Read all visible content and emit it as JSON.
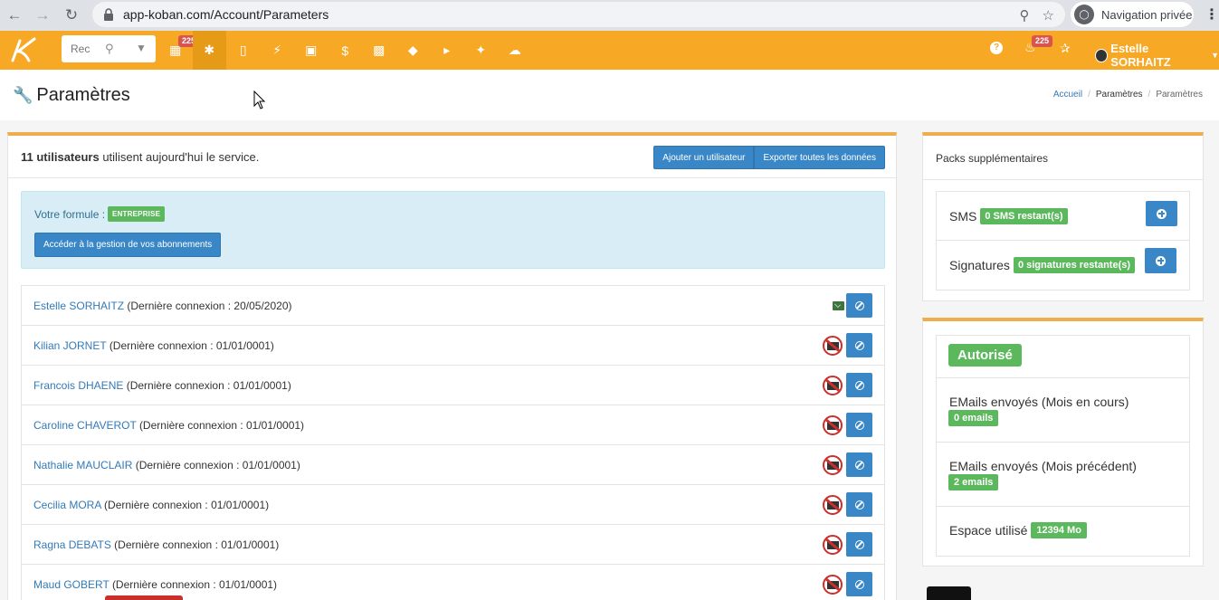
{
  "browser": {
    "url": "app-koban.com/Account/Parameters",
    "incognito_label": "Navigation privée"
  },
  "navbar": {
    "search_placeholder": "Rec",
    "calendar_badge": "225",
    "notification_badge": "225",
    "user_name": "Estelle SORHAITZ",
    "accent_color": "#f7a825"
  },
  "page": {
    "title": "Paramètres",
    "breadcrumb": [
      "Accueil",
      "Paramètres",
      "Paramètres"
    ]
  },
  "main": {
    "user_count": "11 utilisateurs",
    "user_count_suffix": " utilisent aujourd'hui le service.",
    "add_user_button": "Ajouter un utilisateur",
    "export_button": "Exporter toutes les données",
    "formule_label": "Votre formule :",
    "formule_value": "ENTREPRISE",
    "manage_subscriptions_button": "Accéder à la gestion de vos abonnements",
    "users": [
      {
        "name": "Estelle SORHAITZ",
        "last_login": "(Dernière connexion : 20/05/2020)",
        "mail_icon": "envelope-icon"
      },
      {
        "name": "Kilian JORNET",
        "last_login": "(Dernière connexion : 01/01/0001)",
        "mail_icon": "no-mail-icon"
      },
      {
        "name": "Francois DHAENE",
        "last_login": "(Dernière connexion : 01/01/0001)",
        "mail_icon": "no-mail-icon"
      },
      {
        "name": "Caroline CHAVEROT",
        "last_login": "(Dernière connexion : 01/01/0001)",
        "mail_icon": "no-mail-icon"
      },
      {
        "name": "Nathalie MAUCLAIR",
        "last_login": "(Dernière connexion : 01/01/0001)",
        "mail_icon": "no-mail-icon"
      },
      {
        "name": "Cecilia MORA",
        "last_login": "(Dernière connexion : 01/01/0001)",
        "mail_icon": "no-mail-icon"
      },
      {
        "name": "Ragna DEBATS",
        "last_login": "(Dernière connexion : 01/01/0001)",
        "mail_icon": "no-mail-icon"
      },
      {
        "name": "Maud GOBERT",
        "last_login": "(Dernière connexion : 01/01/0001)",
        "mail_icon": "no-mail-icon"
      }
    ]
  },
  "packs": {
    "title": "Packs supplémentaires",
    "sms_label": "SMS",
    "sms_badge": "0 SMS restant(s)",
    "signatures_label": "Signatures",
    "signatures_badge": "0 signatures restante(s)"
  },
  "emails": {
    "status": "Autorisé",
    "current_month_label": "EMails envoyés (Mois en cours)",
    "current_month_value": "0 emails",
    "previous_month_label": "EMails envoyés (Mois précédent)",
    "previous_month_value": "2 emails",
    "space_label": "Espace utilisé",
    "space_value": "12394 Mo"
  }
}
